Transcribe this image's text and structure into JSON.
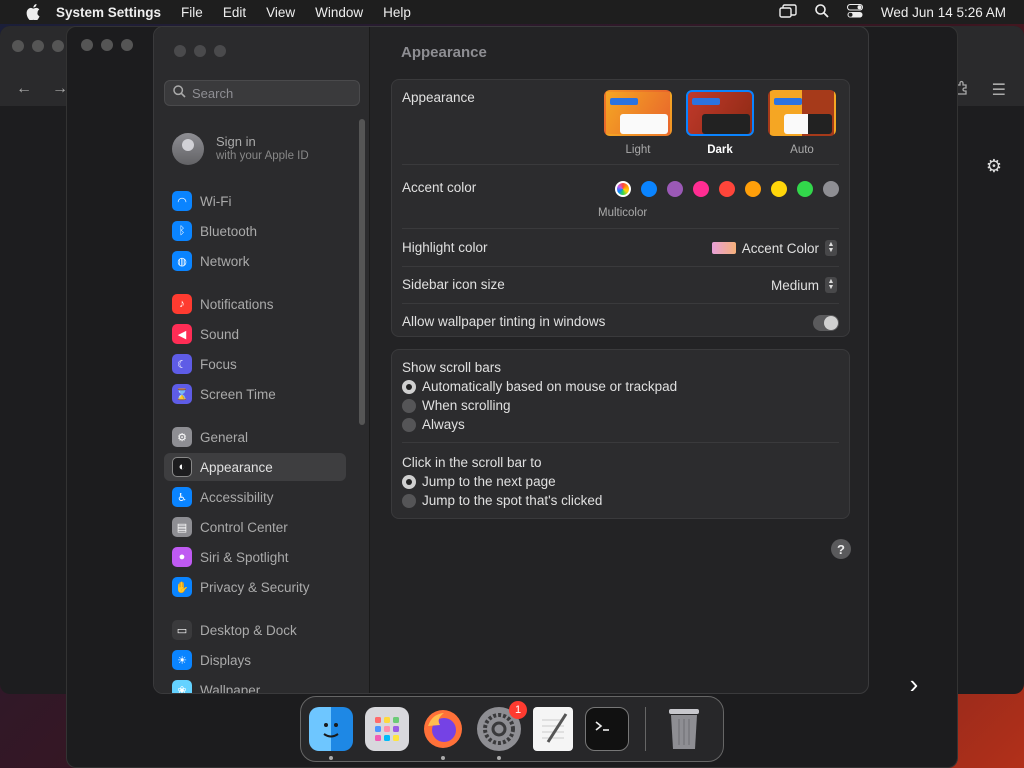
{
  "menubar": {
    "app_name": "System Settings",
    "menus": [
      "File",
      "Edit",
      "View",
      "Window",
      "Help"
    ],
    "datetime": "Wed Jun 14  5:26 AM"
  },
  "sidebar": {
    "search_placeholder": "Search",
    "signin_title": "Sign in",
    "signin_subtitle": "with your Apple ID",
    "groups": [
      [
        {
          "label": "Wi-Fi",
          "icon": "wifi-icon",
          "color": "#0a84ff"
        },
        {
          "label": "Bluetooth",
          "icon": "bluetooth-icon",
          "color": "#0a84ff"
        },
        {
          "label": "Network",
          "icon": "globe-icon",
          "color": "#0a84ff"
        }
      ],
      [
        {
          "label": "Notifications",
          "icon": "bell-icon",
          "color": "#ff3b30"
        },
        {
          "label": "Sound",
          "icon": "speaker-icon",
          "color": "#ff2d55"
        },
        {
          "label": "Focus",
          "icon": "moon-icon",
          "color": "#5e5ce6"
        },
        {
          "label": "Screen Time",
          "icon": "hourglass-icon",
          "color": "#5e5ce6"
        }
      ],
      [
        {
          "label": "General",
          "icon": "gear-icon",
          "color": "#8e8e93"
        },
        {
          "label": "Appearance",
          "icon": "appearance-icon",
          "color": "#1c1c1e",
          "active": true
        },
        {
          "label": "Accessibility",
          "icon": "accessibility-icon",
          "color": "#0a84ff"
        },
        {
          "label": "Control Center",
          "icon": "control-center-icon",
          "color": "#8e8e93"
        },
        {
          "label": "Siri & Spotlight",
          "icon": "siri-icon",
          "color": "#bf5af2"
        },
        {
          "label": "Privacy & Security",
          "icon": "hand-icon",
          "color": "#0a84ff"
        }
      ],
      [
        {
          "label": "Desktop & Dock",
          "icon": "dock-icon",
          "color": "#3a3a3c"
        },
        {
          "label": "Displays",
          "icon": "sun-icon",
          "color": "#0a84ff"
        },
        {
          "label": "Wallpaper",
          "icon": "wallpaper-icon",
          "color": "#64d2ff"
        }
      ]
    ]
  },
  "content": {
    "title": "Appearance",
    "appearance_label": "Appearance",
    "appearance_options": [
      "Light",
      "Dark",
      "Auto"
    ],
    "appearance_selected": "Dark",
    "accent_label": "Accent color",
    "accent_colors": [
      "#0a84ff",
      "#9b59b6",
      "#ff2d92",
      "#ff453a",
      "#ff9f0a",
      "#ffd60a",
      "#32d74b",
      "#8e8e93"
    ],
    "accent_multicolor_label": "Multicolor",
    "highlight_label": "Highlight color",
    "highlight_value": "Accent Color",
    "icon_size_label": "Sidebar icon size",
    "icon_size_value": "Medium",
    "tinting_label": "Allow wallpaper tinting in windows",
    "tinting_on": false,
    "scroll_bars_label": "Show scroll bars",
    "scroll_bar_options": [
      "Automatically based on mouse or trackpad",
      "When scrolling",
      "Always"
    ],
    "scroll_bar_selected": 0,
    "click_label": "Click in the scroll bar to",
    "click_options": [
      "Jump to the next page",
      "Jump to the spot that's clicked"
    ],
    "click_selected": 0,
    "help": "?"
  },
  "dock": {
    "apps": [
      {
        "name": "finder",
        "icon": "finder-icon",
        "running": true
      },
      {
        "name": "launchpad",
        "icon": "launchpad-icon",
        "running": false
      },
      {
        "name": "firefox",
        "icon": "firefox-icon",
        "running": true
      },
      {
        "name": "system-settings",
        "icon": "settings-icon",
        "running": true,
        "badge": "1"
      },
      {
        "name": "textedit",
        "icon": "textedit-icon",
        "running": false
      },
      {
        "name": "terminal",
        "icon": "terminal-icon",
        "running": false
      }
    ],
    "trash": "trash-icon"
  }
}
